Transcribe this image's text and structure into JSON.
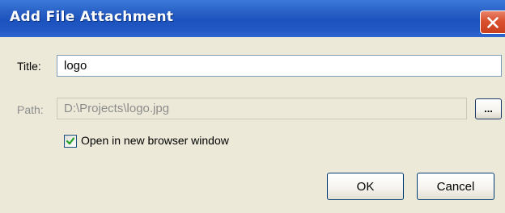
{
  "window": {
    "title": "Add File Attachment",
    "close_icon": "close-icon"
  },
  "form": {
    "title_label": "Title:",
    "title_value": "logo",
    "path_label": "Path:",
    "path_value": "D:\\Projects\\logo.jpg",
    "path_enabled": false,
    "browse_label": "...",
    "open_new_window_label": "Open  in new browser window",
    "open_new_window_checked": true
  },
  "buttons": {
    "ok_label": "OK",
    "cancel_label": "Cancel"
  },
  "colors": {
    "titlebar": "#2a63c8",
    "close_button": "#d9512f",
    "dialog_background": "#ece9d8",
    "checkmark": "#21a121"
  }
}
